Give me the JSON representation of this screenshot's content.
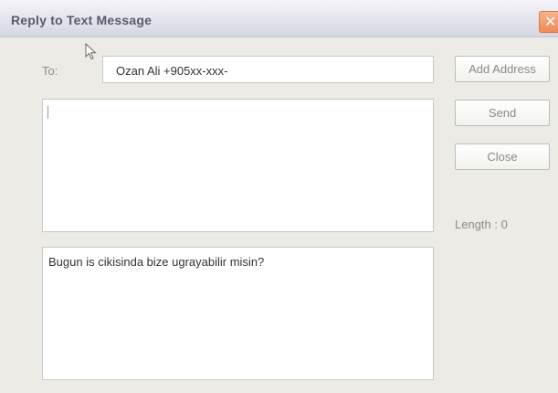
{
  "window": {
    "title": "Reply to Text Message",
    "close_glyph": "✕",
    "close_color": "#ef8a54"
  },
  "recipient": {
    "label": "To:",
    "value": "Ozan Ali  +905xx-xxx-"
  },
  "reply": {
    "value": ""
  },
  "message": {
    "text": "Bugun is cikisinda bize ugrayabilir misin?"
  },
  "buttons": {
    "add_address": "Add Address",
    "send": "Send",
    "close": "Close"
  },
  "length": {
    "text": "Length : 0"
  },
  "icons": {
    "cursor": "mouse-pointer-icon",
    "close": "close-icon"
  }
}
